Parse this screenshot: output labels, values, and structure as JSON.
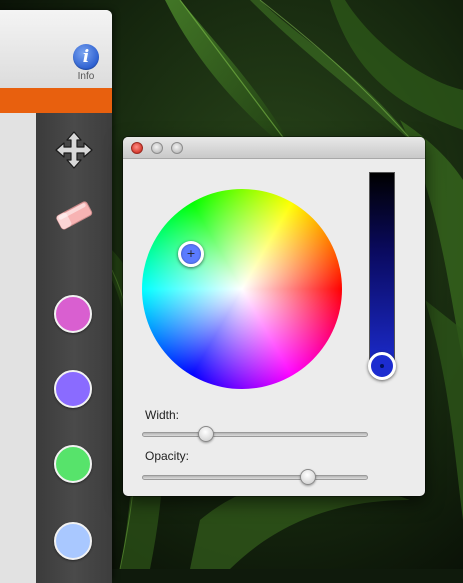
{
  "toolbar": {
    "info_label": "Info",
    "info_glyph": "i",
    "accent_color": "#e8600e"
  },
  "tools": [
    {
      "name": "move-tool",
      "icon": "move-arrows-icon"
    },
    {
      "name": "eraser-tool",
      "icon": "eraser-icon"
    }
  ],
  "swatches": [
    {
      "color": "#d95fd0"
    },
    {
      "color": "#8a6bff"
    },
    {
      "color": "#57e36b"
    },
    {
      "color": "#a9c8ff"
    }
  ],
  "color_picker": {
    "selected_hue_color": "#5b7bff",
    "brightness_color": "#1c2cd0",
    "brightness_level": 0.97,
    "width_label": "Width:",
    "width_value": 0.28,
    "opacity_label": "Opacity:",
    "opacity_value": 0.73
  }
}
